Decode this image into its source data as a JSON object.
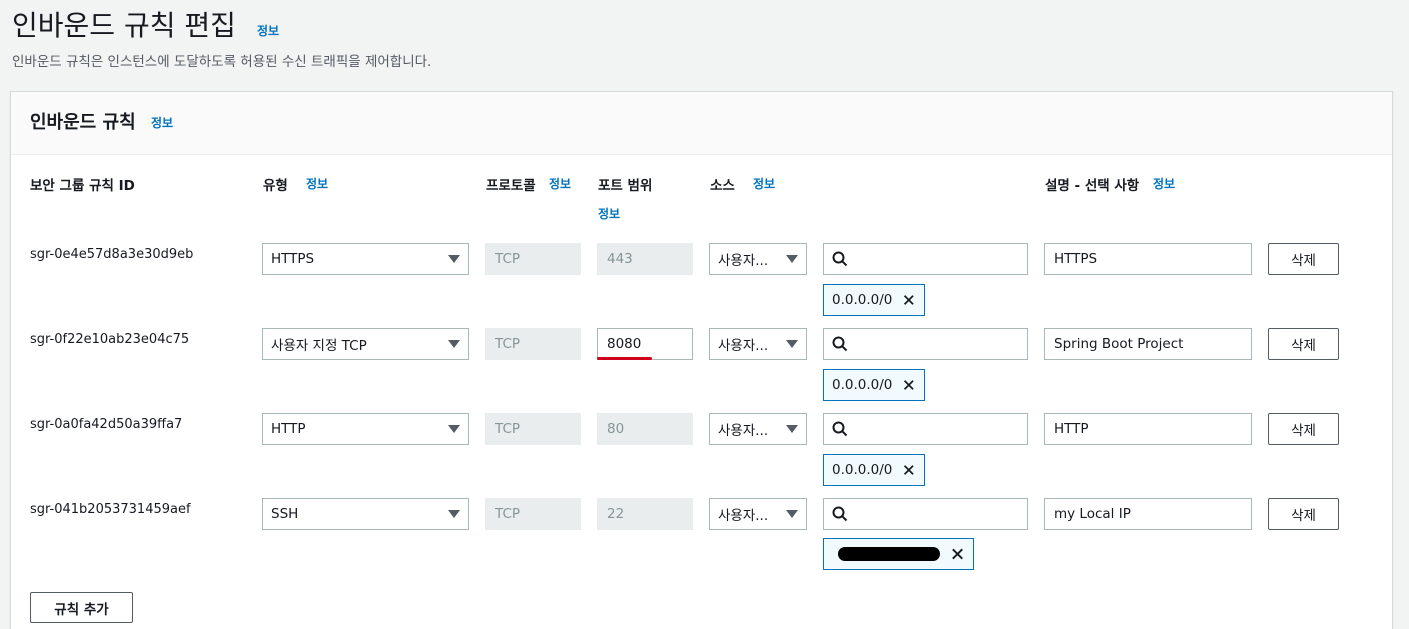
{
  "page": {
    "title": "인바운드 규칙 편집",
    "info": "정보",
    "description": "인바운드 규칙은 인스턴스에 도달하도록 허용된 수신 트래픽을 제어합니다."
  },
  "panel": {
    "title": "인바운드 규칙",
    "info": "정보"
  },
  "columns": {
    "rule_id": "보안 그룹 규칙 ID",
    "type": "유형",
    "type_info": "정보",
    "protocol": "프로토콜",
    "protocol_info": "정보",
    "port_range": "포트 범위",
    "port_range_info": "정보",
    "source": "소스",
    "source_info": "정보",
    "description": "설명 - 선택 사항",
    "description_info": "정보"
  },
  "rules": [
    {
      "id": "sgr-0e4e57d8a3e30d9eb",
      "type": "HTTPS",
      "protocol": "TCP",
      "port": "443",
      "source_type": "사용자...",
      "cidr": "0.0.0.0/0",
      "description": "HTTPS",
      "delete": "삭제"
    },
    {
      "id": "sgr-0f22e10ab23e04c75",
      "type": "사용자 지정 TCP",
      "protocol": "TCP",
      "port": "8080",
      "source_type": "사용자...",
      "cidr": "0.0.0.0/0",
      "description": "Spring Boot Project",
      "delete": "삭제"
    },
    {
      "id": "sgr-0a0fa42d50a39ffa7",
      "type": "HTTP",
      "protocol": "TCP",
      "port": "80",
      "source_type": "사용자...",
      "cidr": "0.0.0.0/0",
      "description": "HTTP",
      "delete": "삭제"
    },
    {
      "id": "sgr-041b2053731459aef",
      "type": "SSH",
      "protocol": "TCP",
      "port": "22",
      "source_type": "사용자...",
      "cidr": "",
      "description": "my Local IP",
      "delete": "삭제"
    }
  ],
  "actions": {
    "add_rule": "규칙 추가"
  },
  "icons": {
    "search": "search-icon",
    "remove": "close-icon",
    "dropdown": "caret-down-icon"
  },
  "colors": {
    "link": "#0073bb",
    "token_border": "#0073bb",
    "annotation": "#d0021b"
  }
}
